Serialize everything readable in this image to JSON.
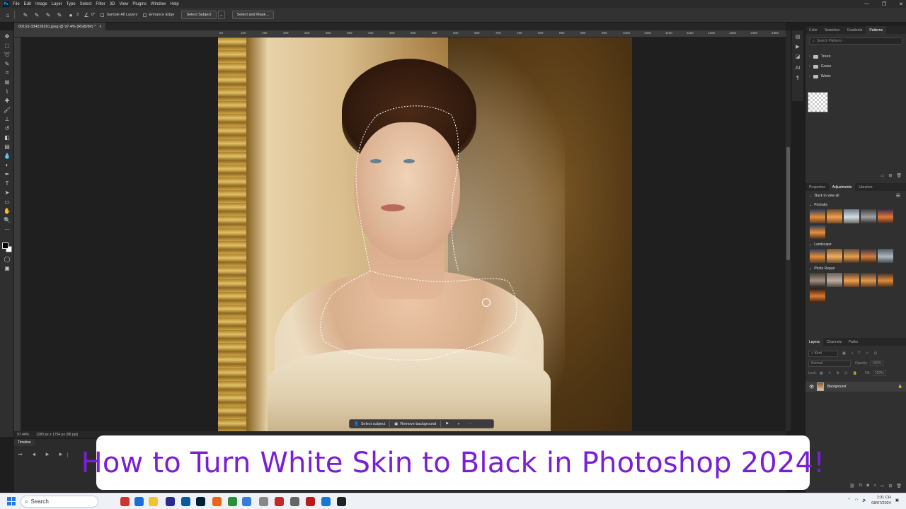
{
  "menubar": {
    "app_logo": "Ps",
    "items": [
      "File",
      "Edit",
      "Image",
      "Layer",
      "Type",
      "Select",
      "Filter",
      "3D",
      "View",
      "Plugins",
      "Window",
      "Help"
    ]
  },
  "options": {
    "size_value": "3",
    "angle_value": "0°",
    "sample_all_layers": "Sample All Layers",
    "enhance_edge": "Enhance Edge",
    "select_subject": "Select Subject",
    "select_and_mask": "Select and Mask..."
  },
  "document": {
    "tab_title": "00153-334228291.jpeg @ 97.4% (RGB/8#) *"
  },
  "ruler": {
    "ticks": [
      "50",
      "100",
      "150",
      "200",
      "250",
      "300",
      "350",
      "400",
      "450",
      "500",
      "550",
      "600",
      "650",
      "700",
      "750",
      "800",
      "850",
      "900",
      "950",
      "1000",
      "1050",
      "1100",
      "1150",
      "1200",
      "1250",
      "1300",
      "1350",
      "1400",
      "1450",
      "1500",
      "1550",
      "1600",
      "1650",
      "1700",
      "1750"
    ]
  },
  "context_bar": {
    "select_subject": "Select subject",
    "remove_background": "Remove background"
  },
  "status": {
    "zoom": "97.44%",
    "doc_size": "1280 px x 1754 px (96 ppi)"
  },
  "timeline": {
    "tab": "Timeline"
  },
  "patterns_panel": {
    "tabs": [
      "Color",
      "Swatches",
      "Gradients",
      "Patterns"
    ],
    "active_tab": "Patterns",
    "search_placeholder": "Search Patterns",
    "folders": [
      "Trees",
      "Grass",
      "Water"
    ]
  },
  "adjustments_panel": {
    "tabs": [
      "Properties",
      "Adjustments",
      "Libraries"
    ],
    "active_tab": "Adjustments",
    "back_label": "Back to view all",
    "sections": [
      "Portraits",
      "Landscape",
      "Photo Repair"
    ]
  },
  "layers_panel": {
    "tabs": [
      "Layers",
      "Channels",
      "Paths"
    ],
    "active_tab": "Layers",
    "kind_label": "Kind",
    "blend_mode": "Normal",
    "opacity_label": "Opacity:",
    "opacity_value": "100%",
    "lock_label": "Lock:",
    "fill_label": "Fill:",
    "fill_value": "100%",
    "layer_name": "Background"
  },
  "banner": {
    "text": "How to Turn White Skin to Black in Photoshop 2024!"
  },
  "taskbar": {
    "search_label": "Search",
    "time": "1:31 CH",
    "date": "08/07/2024"
  },
  "colors": {
    "banner_text": "#7a1fd6",
    "ps_blue": "#31a8ff"
  }
}
